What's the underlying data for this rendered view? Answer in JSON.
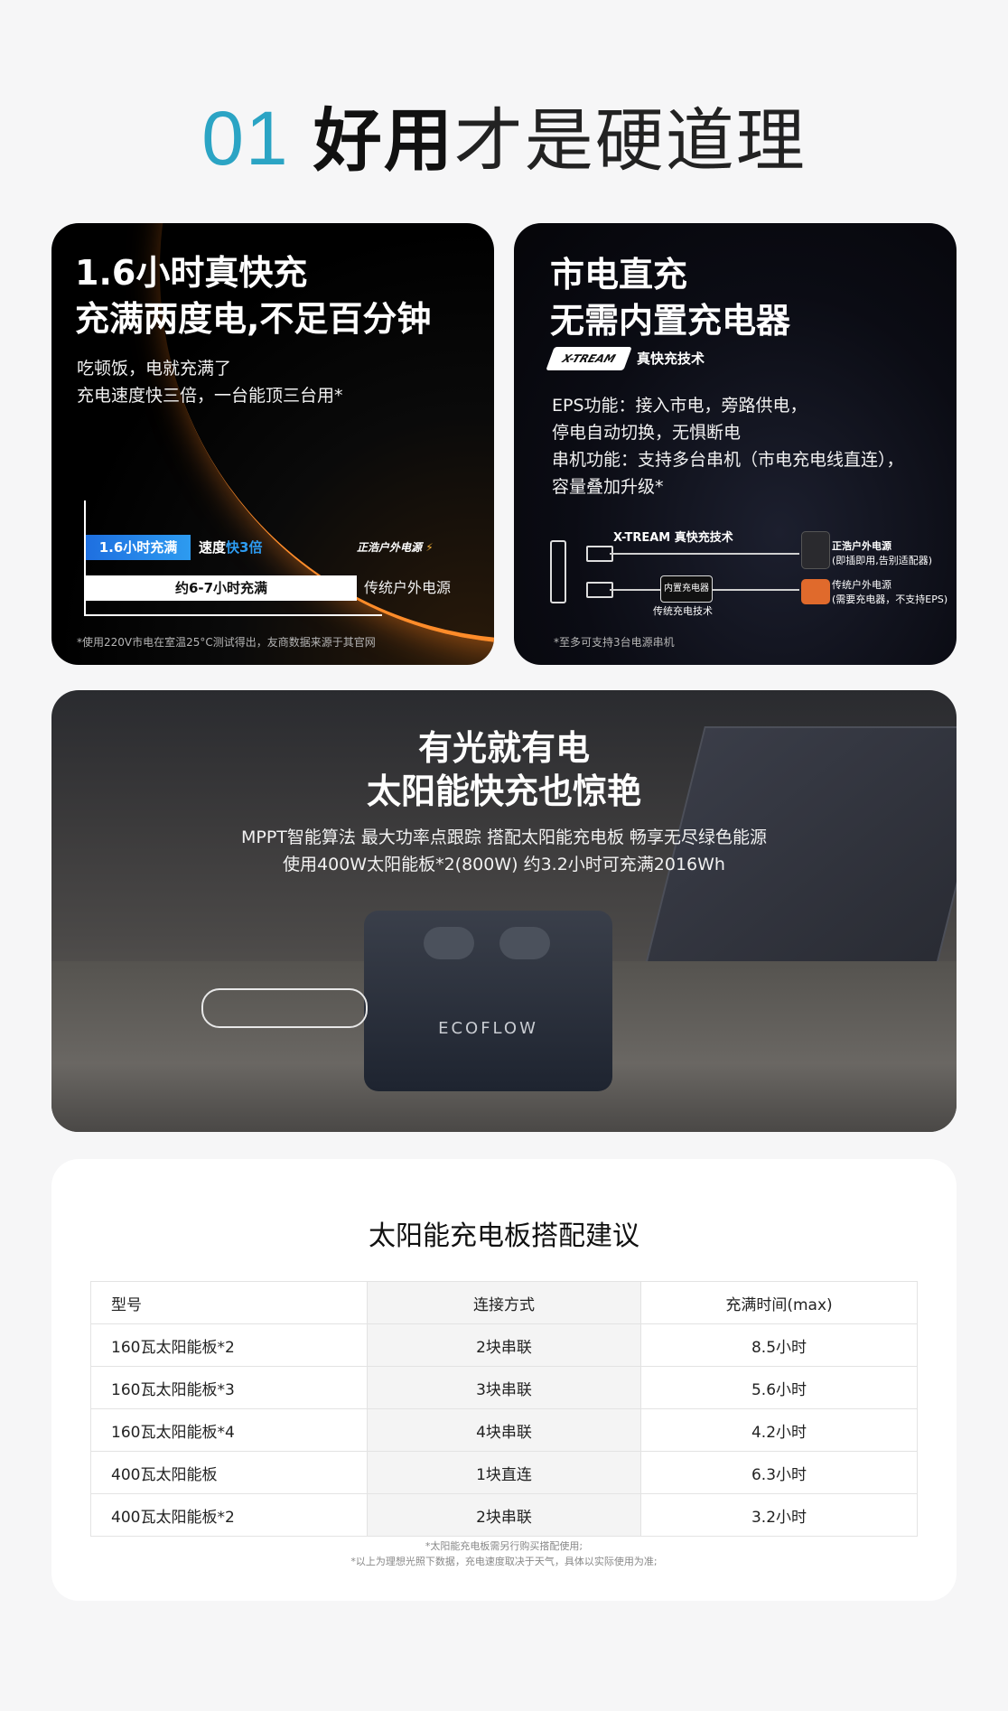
{
  "headline": {
    "num": "01",
    "bold": "好用",
    "light": "才是硬道理"
  },
  "card1": {
    "title_line1": "1.6小时真快充",
    "title_line2": "充满两度电,不足百分钟",
    "sub_line1": "吃顿饭，电就充满了",
    "sub_line2": "充电速度快三倍，一台能顶三台用*",
    "bar_fast_label": "1.6小时充满",
    "speed_label": "速度",
    "speed_highlight": "快3倍",
    "brand_label": "正浩户外电源",
    "bar_slow_label": "约6-7小时充满",
    "slow_brand_label": "传统户外电源",
    "footnote": "*使用220V市电在室温25°C测试得出，友商数据来源于其官网",
    "accent": "#2d9bf0"
  },
  "card2": {
    "title_line1": "市电直充",
    "title_line2": "无需内置充电器",
    "badge": "X-TREAM",
    "badge_text": "真快充技术",
    "body_line1": "EPS功能：接入市电，旁路供电，",
    "body_line2": "停电自动切换，无惧断电",
    "body_line3": "串机功能：支持多台串机（市电充电线直连），",
    "body_line4": "容量叠加升级*",
    "diag_top_label": "X-TREAM 真快充技术",
    "diag_box_label": "内置充电器",
    "diag_bottom_label": "传统充电技术",
    "right_top_title": "正浩户外电源",
    "right_top_sub": "(即插即用,告别适配器)",
    "right_bottom_title": "传统户外电源",
    "right_bottom_sub": "(需要充电器，不支持EPS)",
    "footnote": "*至多可支持3台电源串机"
  },
  "card3": {
    "title_line1": "有光就有电",
    "title_line2": "太阳能快充也惊艳",
    "sub_line1": "MPPT智能算法 最大功率点跟踪 搭配太阳能充电板 畅享无尽绿色能源",
    "sub_line2": "使用400W太阳能板*2(800W) 约3.2小时可充满2016Wh",
    "product_logo": "ECOFLOW"
  },
  "table": {
    "title": "太阳能充电板搭配建议",
    "headers": [
      "型号",
      "连接方式",
      "充满时间(max)"
    ],
    "rows": [
      [
        "160瓦太阳能板*2",
        "2块串联",
        "8.5小时"
      ],
      [
        "160瓦太阳能板*3",
        "3块串联",
        "5.6小时"
      ],
      [
        "160瓦太阳能板*4",
        "4块串联",
        "4.2小时"
      ],
      [
        "400瓦太阳能板",
        "1块直连",
        "6.3小时"
      ],
      [
        "400瓦太阳能板*2",
        "2块串联",
        "3.2小时"
      ]
    ],
    "note1": "*太阳能充电板需另行购买搭配使用;",
    "note2": "*以上为理想光照下数据，充电速度取决于天气，具体以实际使用为准;"
  }
}
